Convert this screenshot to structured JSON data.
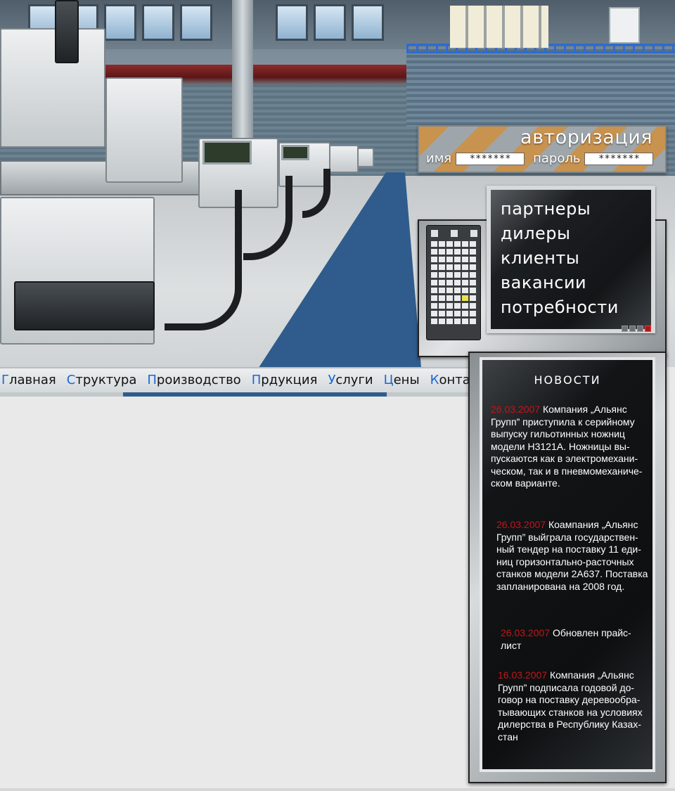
{
  "auth": {
    "title": "авторизация",
    "name_label": "имя",
    "name_value": "*******",
    "password_label": "пароль",
    "password_value": "*******"
  },
  "menu": {
    "items": [
      {
        "label": "партнеры"
      },
      {
        "label": "дилеры"
      },
      {
        "label": "клиенты"
      },
      {
        "label": "вакансии"
      },
      {
        "label": "потребности"
      }
    ]
  },
  "nav": {
    "items": [
      {
        "first": "Г",
        "rest": "лавная"
      },
      {
        "first": "С",
        "rest": "труктура"
      },
      {
        "first": "П",
        "rest": "роизводство"
      },
      {
        "first": "П",
        "rest": "рдукция"
      },
      {
        "first": "У",
        "rest": "слуги"
      },
      {
        "first": "Ц",
        "rest": "ены"
      },
      {
        "first": "К",
        "rest": "онтакты"
      }
    ]
  },
  "news": {
    "title": "новости",
    "items": [
      {
        "date": "26.03.2007",
        "text": "Компания „Альянс Групп” приступила к серийному выпуску гильотинных ножниц модели Н3121А. Ножницы вы-пускаются как в электромехани-ческом, так и в пневмомеханиче-ском варианте."
      },
      {
        "date": "26.03.2007",
        "text": "Коампания „Альянс Групп” выйграла государствен-ный тендер на поставку 11 еди-ниц горизонтально-расточных станков модели 2А637. Поставка запланирована на 2008 год."
      },
      {
        "date": "26.03.2007",
        "text": "Обновлен прайс-лист"
      },
      {
        "date": "16.03.2007",
        "text": "Компания „Альянс Групп” подписала годовой до-говор на поставку деревообра-тывающих станков на условиях дилерства в Республику Казах-стан"
      }
    ]
  },
  "colors": {
    "nav_accent": "#1b67d6",
    "news_date": "#c4151b"
  }
}
